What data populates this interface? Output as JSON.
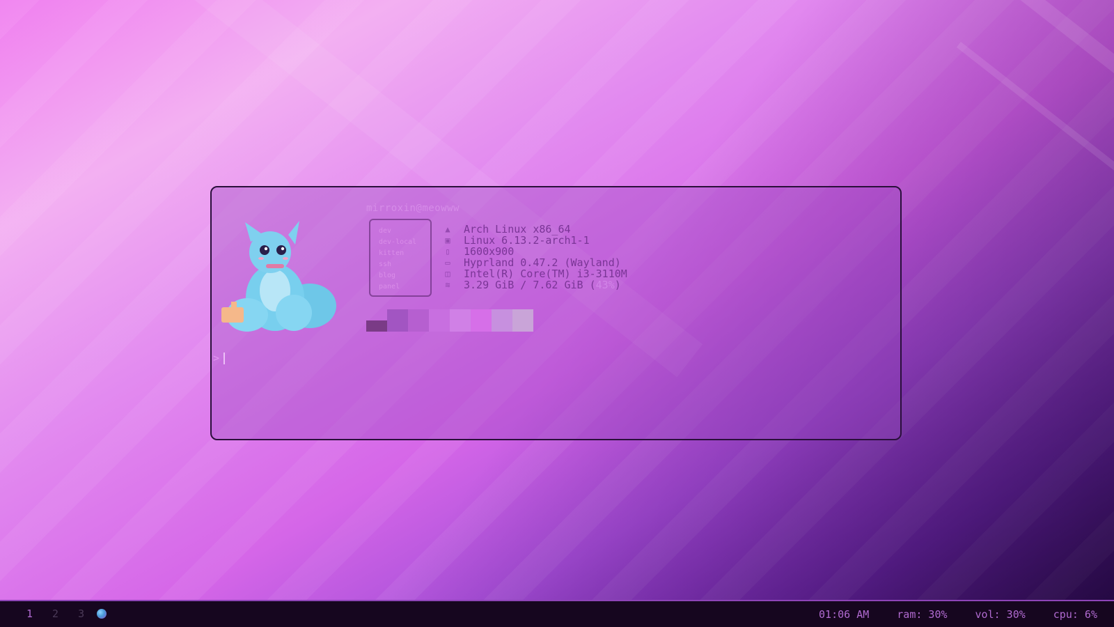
{
  "terminal": {
    "user_host": "mirroxin@meowww",
    "box_labels": [
      "dev",
      "dev-local",
      "kitten",
      "ssh",
      "blog",
      "panel"
    ],
    "info_icons": [
      "arch-icon",
      "kernel-icon",
      "monitor-icon",
      "window-manager-icon",
      "cpu-icon",
      "memory-icon"
    ],
    "info_lines": [
      "Arch Linux x86_64",
      "Linux 6.13.2-arch1-1",
      "1600x900",
      "Hyprland 0.47.2 (Wayland)",
      "Intel(R) Core(TM) i3-3110M"
    ],
    "memory_line": "3.29 GiB / 7.62 GiB",
    "memory_note": "43%",
    "palette": [
      "#7a3b86",
      "#a255c2",
      "#b65fd0",
      "#c86fe0",
      "#d080e6",
      "#d66fe8",
      "#c790df",
      "#c9a4d8"
    ],
    "prompt": ">"
  },
  "bar": {
    "workspaces": [
      "1",
      "2",
      "3"
    ],
    "active_workspace": "1",
    "app_icon": "app-orb-icon",
    "clock": "01:06 AM",
    "ram": "ram: 30%",
    "vol": "vol: 30%",
    "cpu": "cpu: 6%"
  },
  "colors": {
    "bar_bg": "#16061f",
    "bar_accent": "#b06ad0",
    "terminal_text": "#7a3596"
  }
}
